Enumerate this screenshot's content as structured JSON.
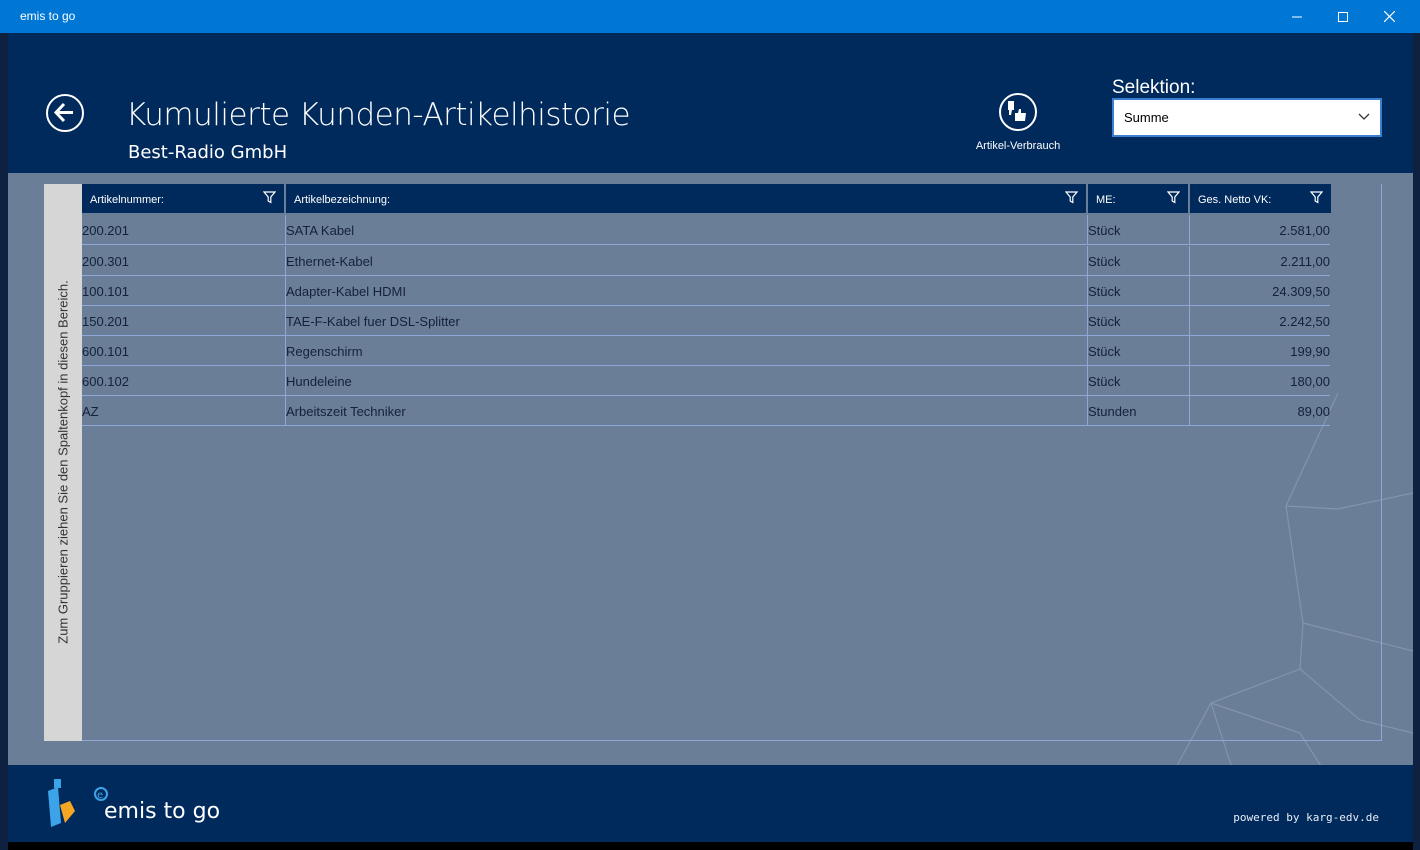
{
  "window": {
    "title": "emis to go",
    "controls": {
      "minimize": "—",
      "maximize": "☐",
      "close": "✕"
    }
  },
  "header": {
    "title": "Kumulierte Kunden-Artikelhistorie",
    "subtitle": "Best-Radio GmbH",
    "action_label": "Artikel-Verbrauch",
    "selection_label": "Selektion:",
    "selection_value": "Summe"
  },
  "group_panel": {
    "hint": "Zum Gruppieren ziehen Sie den Spaltenkopf in diesen Bereich."
  },
  "table": {
    "columns": [
      "Artikelnummer:",
      "Artikelbezeichnung:",
      "ME:",
      "Ges. Netto VK:"
    ],
    "rows": [
      [
        "200.201",
        "SATA Kabel",
        "Stück",
        "2.581,00"
      ],
      [
        "200.301",
        "Ethernet-Kabel",
        "Stück",
        "2.211,00"
      ],
      [
        "100.101",
        "Adapter-Kabel HDMI",
        "Stück",
        "24.309,50"
      ],
      [
        "150.201",
        "TAE-F-Kabel fuer DSL-Splitter",
        "Stück",
        "2.242,50"
      ],
      [
        "600.101",
        "Regenschirm",
        "Stück",
        "199,90"
      ],
      [
        "600.102",
        "Hundeleine",
        "Stück",
        "180,00"
      ],
      [
        "AZ",
        "Arbeitszeit Techniker",
        "Stunden",
        "89,00"
      ]
    ]
  },
  "footer": {
    "brand": "emis to go",
    "powered_by": "powered by karg-edv.de"
  },
  "colors": {
    "titlebar": "#0077d5",
    "header": "#002a5c",
    "content": "#6a7e97",
    "grid_line": "#8ea7d8",
    "text_dark": "#15213a"
  }
}
